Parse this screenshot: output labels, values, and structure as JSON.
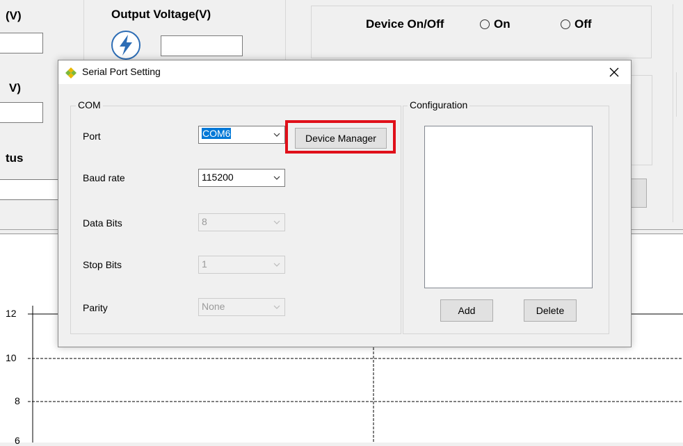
{
  "background": {
    "input_voltage_label_fragment": "(V)",
    "output_voltage_label": "Output Voltage(V)",
    "second_label_fragment": "V)",
    "status_label_fragment": "tus",
    "device_onoff_label": "Device On/Off",
    "radio_on_label": "On",
    "radio_off_label": "Off"
  },
  "chart": {
    "y_ticks": [
      "12",
      "10",
      "8",
      "6"
    ]
  },
  "chart_data": {
    "type": "line",
    "title": "",
    "xlabel": "",
    "ylabel": "",
    "y_tick_labels": [
      "12",
      "10",
      "8",
      "6"
    ],
    "grid": true,
    "series": []
  },
  "dialog": {
    "title": "Serial Port Setting",
    "com_group_label": "COM",
    "port_label": "Port",
    "port_value": "COM6",
    "device_manager_button": "Device Manager",
    "baud_label": "Baud rate",
    "baud_value": "115200",
    "databits_label": "Data Bits",
    "databits_value": "8",
    "stopbits_label": "Stop Bits",
    "stopbits_value": "1",
    "parity_label": "Parity",
    "parity_value": "None",
    "config_group_label": "Configuration",
    "add_button": "Add",
    "delete_button": "Delete",
    "highlight_color": "#e0101a"
  }
}
